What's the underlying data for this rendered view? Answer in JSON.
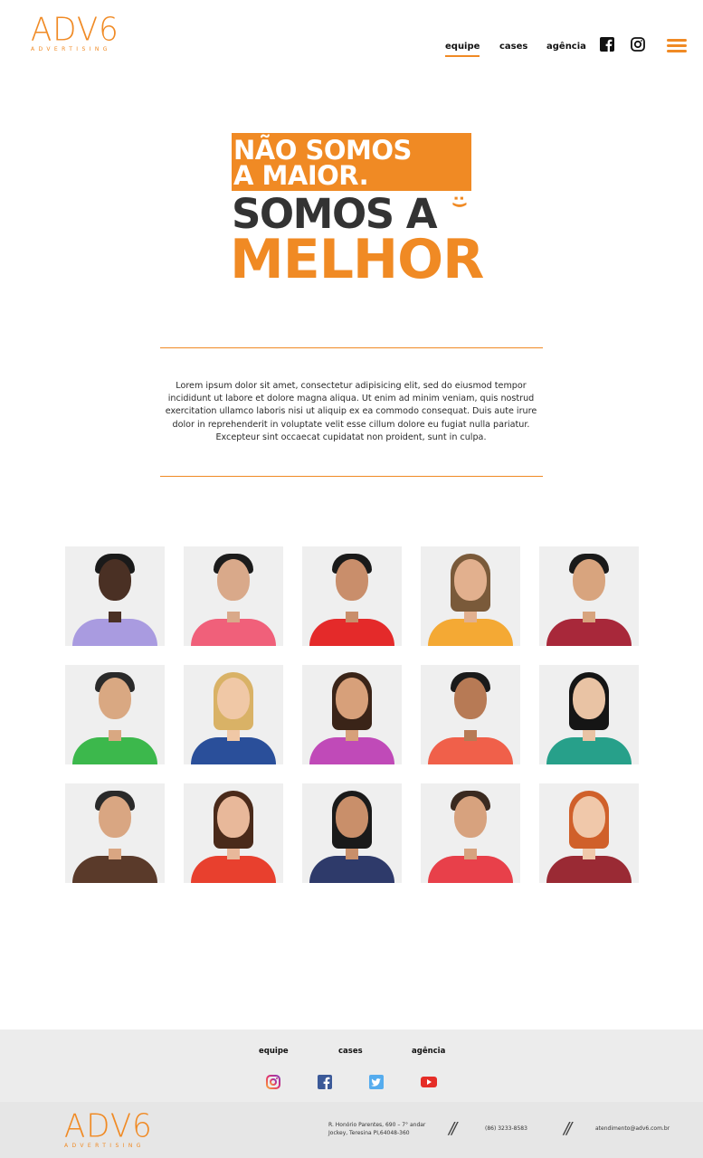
{
  "header": {
    "logo_text": "ADV6",
    "logo_sub": "ADVERTISING",
    "nav": [
      {
        "label": "equipe",
        "active": true
      },
      {
        "label": "cases",
        "active": false
      },
      {
        "label": "agência",
        "active": false
      }
    ],
    "icons": [
      "facebook-icon",
      "instagram-icon",
      "menu-icon"
    ]
  },
  "hero": {
    "line1": "NÃO SOMOS",
    "line2": "A MAIOR.",
    "line3": "SOMOS A",
    "smile": ":)",
    "line4": "MELHOR"
  },
  "intro": {
    "text": "Lorem ipsum dolor sit amet, consectetur adipisicing elit, sed do eiusmod tempor incididunt ut labore et dolore magna aliqua. Ut enim ad minim veniam, quis nostrud exercitation ullamco laboris nisi ut aliquip ex ea commodo consequat. Duis aute irure dolor in reprehenderit in voluptate velit esse cillum dolore eu fugiat nulla pariatur. Excepteur sint occaecat cupidatat non proident, sunt in culpa."
  },
  "team": [
    {
      "skin": "#4a3024",
      "hair": "#1a1a1a",
      "shirt": "#a99be0",
      "long": false
    },
    {
      "skin": "#d9a98a",
      "hair": "#1c1c1c",
      "shirt": "#f0607a",
      "long": false
    },
    {
      "skin": "#c98e6b",
      "hair": "#1a1a1a",
      "shirt": "#e42a2a",
      "long": false
    },
    {
      "skin": "#e2b08e",
      "hair": "#7a5a3a",
      "shirt": "#f4a934",
      "long": true
    },
    {
      "skin": "#d8a47e",
      "hair": "#1a1a1a",
      "shirt": "#a8283a",
      "long": false
    },
    {
      "skin": "#d9a882",
      "hair": "#2a2a2a",
      "shirt": "#3cb84c",
      "long": false
    },
    {
      "skin": "#f0c8a6",
      "hair": "#d9b266",
      "shirt": "#2a4f9a",
      "long": true
    },
    {
      "skin": "#d7a07a",
      "hair": "#3a2418",
      "shirt": "#c04ab8",
      "long": true
    },
    {
      "skin": "#b77a55",
      "hair": "#1a1a1a",
      "shirt": "#f0604a",
      "long": false
    },
    {
      "skin": "#e9c3a4",
      "hair": "#151515",
      "shirt": "#27a08a",
      "long": true
    },
    {
      "skin": "#d9a682",
      "hair": "#2a2a2a",
      "shirt": "#5a3a2a",
      "long": false
    },
    {
      "skin": "#e8b89a",
      "hair": "#4a2a1a",
      "shirt": "#e8402e",
      "long": true
    },
    {
      "skin": "#c98f6a",
      "hair": "#1a1a1a",
      "shirt": "#2e3a6a",
      "long": true
    },
    {
      "skin": "#d7a27e",
      "hair": "#3a2a20",
      "shirt": "#e8404a",
      "long": false
    },
    {
      "skin": "#f0c8aa",
      "hair": "#d0602a",
      "shirt": "#9a2a34",
      "long": true
    }
  ],
  "footer": {
    "nav": [
      "equipe",
      "cases",
      "agência"
    ],
    "social": [
      "instagram-icon",
      "facebook-icon",
      "twitter-icon",
      "youtube-icon"
    ],
    "logo_text": "ADV6",
    "logo_sub": "ADVERTISING",
    "address_line1": "R. Honório Parentes, 690 – 7° andar",
    "address_line2": "Jockey, Teresina PI,64048-360",
    "phone": "(86) 3233-8583",
    "email": "atendimento@adv6.com.br",
    "separator": "//"
  },
  "colors": {
    "accent": "#f08a24",
    "dark": "#333333",
    "footer_bg": "#ececec"
  }
}
